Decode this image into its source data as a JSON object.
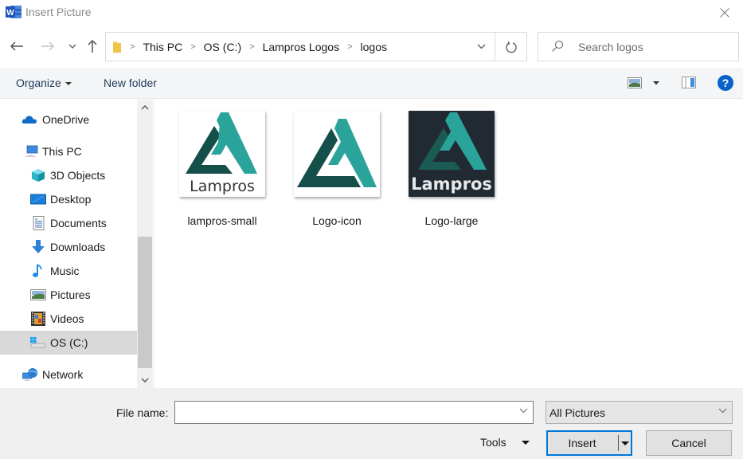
{
  "window": {
    "title": "Insert Picture",
    "app_icon": "word-icon"
  },
  "navigation": {
    "back": "back-arrow-icon",
    "forward": "forward-arrow-icon",
    "recent": "recent-locations-chevron-icon",
    "up": "up-arrow-icon"
  },
  "address": {
    "breadcrumbs": [
      "This PC",
      "OS (C:)",
      "Lampros Logos",
      "logos"
    ]
  },
  "search": {
    "placeholder": "Search logos",
    "value": ""
  },
  "command_bar": {
    "organize_label": "Organize",
    "new_folder_label": "New folder"
  },
  "nav_pane": {
    "items": [
      {
        "label": "OneDrive",
        "icon": "onedrive-cloud-icon",
        "level": 0,
        "selected": false
      },
      {
        "label": "This PC",
        "icon": "this-pc-icon",
        "level": 0,
        "selected": false
      },
      {
        "label": "3D Objects",
        "icon": "3d-objects-icon",
        "level": 1,
        "selected": false
      },
      {
        "label": "Desktop",
        "icon": "desktop-icon",
        "level": 1,
        "selected": false
      },
      {
        "label": "Documents",
        "icon": "documents-icon",
        "level": 1,
        "selected": false
      },
      {
        "label": "Downloads",
        "icon": "downloads-icon",
        "level": 1,
        "selected": false
      },
      {
        "label": "Music",
        "icon": "music-icon",
        "level": 1,
        "selected": false
      },
      {
        "label": "Pictures",
        "icon": "pictures-icon",
        "level": 1,
        "selected": false
      },
      {
        "label": "Videos",
        "icon": "videos-icon",
        "level": 1,
        "selected": false
      },
      {
        "label": "OS (C:)",
        "icon": "drive-icon",
        "level": 1,
        "selected": true
      },
      {
        "label": "Network",
        "icon": "network-icon",
        "level": 0,
        "selected": false
      }
    ]
  },
  "files": [
    {
      "name": "lampros-small",
      "variant": "light-with-text"
    },
    {
      "name": "Logo-icon",
      "variant": "light-icon-only"
    },
    {
      "name": "Logo-large",
      "variant": "dark-with-text"
    }
  ],
  "logo_text": "Lampros",
  "colors": {
    "logo_dark_teal": "#154f4a",
    "logo_light_teal": "#2aa39b",
    "logo_dark_bg": "#212a33",
    "accent": "#0078d7",
    "help_blue": "#0a63c9"
  },
  "footer": {
    "file_name_label": "File name:",
    "file_name_value": "",
    "file_type_selected": "All Pictures",
    "tools_label": "Tools",
    "insert_label": "Insert",
    "cancel_label": "Cancel"
  }
}
